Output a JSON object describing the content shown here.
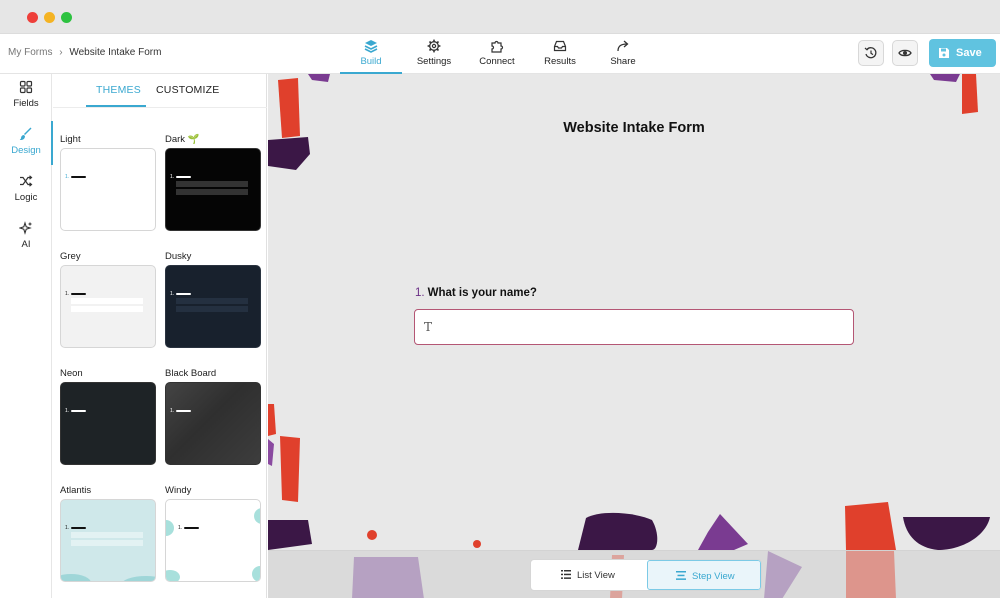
{
  "window": {
    "traffic_lights": [
      "#ee3f3a",
      "#f4b323",
      "#2dc240"
    ]
  },
  "topbar": {
    "breadcrumb": {
      "root": "My Forms",
      "separator": "›",
      "current": "Website Intake Form"
    },
    "tabs": [
      {
        "label": "Build",
        "icon": "layers-icon",
        "active": true
      },
      {
        "label": "Settings",
        "icon": "gear-icon",
        "active": false
      },
      {
        "label": "Connect",
        "icon": "puzzle-icon",
        "active": false
      },
      {
        "label": "Results",
        "icon": "inbox-icon",
        "active": false
      },
      {
        "label": "Share",
        "icon": "share-arrow-icon",
        "active": false
      }
    ],
    "history_icon": "history-icon",
    "preview_icon": "eye-icon",
    "save_label": "Save",
    "accent": "#3aa8d0",
    "save_color": "#60c3e0"
  },
  "leftrail": {
    "items": [
      {
        "label": "Fields",
        "icon": "grid-icon",
        "active": false
      },
      {
        "label": "Design",
        "icon": "brush-icon",
        "active": true
      },
      {
        "label": "Logic",
        "icon": "shuffle-icon",
        "active": false
      },
      {
        "label": "AI",
        "icon": "sparkle-icon",
        "active": false
      }
    ]
  },
  "panel": {
    "tabs": [
      "THEMES",
      "CUSTOMIZE"
    ],
    "active_tab": "THEMES",
    "themes": [
      {
        "name": "Light",
        "bg": "#ffffff",
        "fg": "#111111"
      },
      {
        "name": "Dark",
        "badge": "🌱",
        "bg": "#050505",
        "fg": "#ffffff"
      },
      {
        "name": "Grey",
        "bg": "#f2f2f2",
        "fg": "#111111"
      },
      {
        "name": "Dusky",
        "bg": "#18212d",
        "fg": "#ffffff"
      },
      {
        "name": "Neon",
        "bg": "#1e2326",
        "fg": "#ffffff"
      },
      {
        "name": "Black Board",
        "bg": "#3a3a3a",
        "fg": "#ffffff"
      },
      {
        "name": "Atlantis",
        "bg": "#cfe8ea",
        "fg": "#111111"
      },
      {
        "name": "Windy",
        "bg": "#ffffff",
        "fg": "#111111"
      }
    ],
    "question_number_label": "1."
  },
  "form": {
    "title": "Website Intake Form",
    "question_number": "1.",
    "question_text": "What is your name?",
    "field_icon_glyph": "T",
    "answer_value": ""
  },
  "viewbar": {
    "list_view_label": "List View",
    "step_view_label": "Step View",
    "active": "Step View"
  }
}
